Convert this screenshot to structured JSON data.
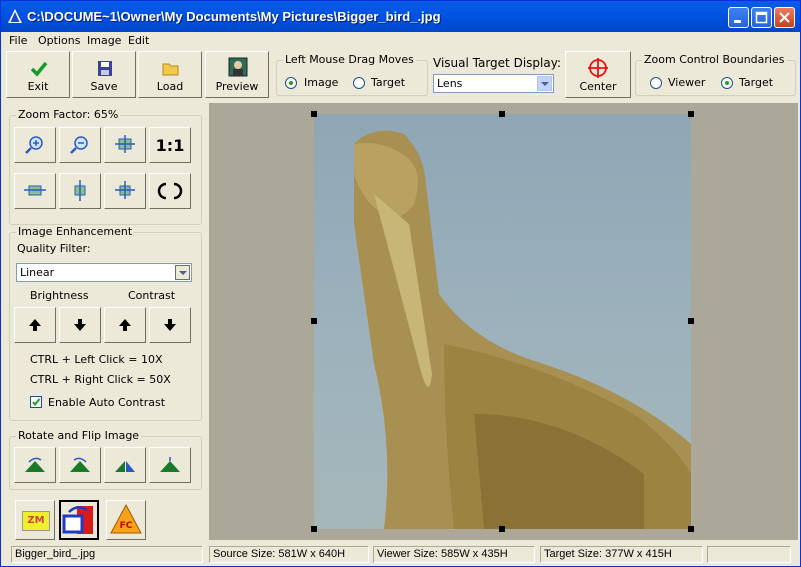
{
  "window": {
    "title": "C:\\DOCUME~1\\Owner\\My Documents\\My Pictures\\Bigger_bird_.jpg"
  },
  "menu": [
    "File",
    "Options",
    "Image",
    "Edit"
  ],
  "toolbar": {
    "exit": "Exit",
    "save": "Save",
    "load": "Load",
    "preview": "Preview",
    "center": "Center"
  },
  "drag_moves": {
    "title": "Left Mouse Drag Moves",
    "image": "Image",
    "target": "Target",
    "selected": "image"
  },
  "visual_target": {
    "title": "Visual Target Display:",
    "value": "Lens"
  },
  "zoom_bounds": {
    "title": "Zoom Control Boundaries",
    "viewer": "Viewer",
    "target": "Target",
    "selected": "target"
  },
  "zoom": {
    "title": "Zoom Factor: 65%",
    "one_to_one": "1:1"
  },
  "enhance": {
    "title": "Image Enhancement",
    "quality_label": "Quality Filter:",
    "quality_value": "Linear",
    "brightness": "Brightness",
    "contrast": "Contrast",
    "hint1": "CTRL + Left Click = 10X",
    "hint2": "CTRL + Right Click = 50X",
    "auto_contrast": "Enable Auto Contrast",
    "auto_contrast_checked": true
  },
  "rotate": {
    "title": "Rotate and Flip Image"
  },
  "bottom_buttons": {
    "zm": "ZM",
    "fc": "FC"
  },
  "status": {
    "file": "Bigger_bird_.jpg",
    "source": "Source Size: 581W x 640H",
    "viewer": "Viewer Size: 585W x 435H",
    "target": "Target Size: 377W x 415H"
  },
  "colors": {
    "titlebar": "#0054E3",
    "face": "#ECE9D8",
    "viewer_bg": "#ACA899"
  }
}
